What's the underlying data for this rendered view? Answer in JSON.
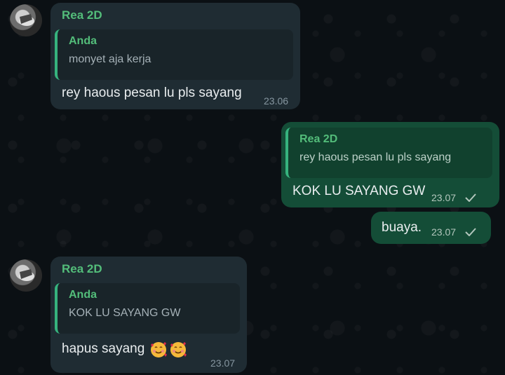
{
  "messages": [
    {
      "direction": "incoming",
      "sender": "Rea 2D",
      "quote_author": "Anda",
      "quote_text": "monyet aja kerja",
      "text": "rey haous pesan lu pls sayang",
      "time": "23.06"
    },
    {
      "direction": "outgoing",
      "quote_author": "Rea 2D",
      "quote_text": "rey haous pesan lu pls sayang",
      "text": "KOK LU SAYANG GW",
      "time": "23.07",
      "status": "check-icon"
    },
    {
      "direction": "outgoing",
      "text": "buaya.",
      "time": "23.07",
      "status": "check-icon"
    },
    {
      "direction": "incoming",
      "sender": "Rea 2D",
      "quote_author": "Anda",
      "quote_text": "KOK LU SAYANG GW",
      "text": "hapus sayang",
      "emoji": [
        "smiling-face-with-hearts-emoji",
        "smiling-face-with-hearts-emoji"
      ],
      "time": "23.07"
    }
  ],
  "colors": {
    "incoming_bubble": "#1f2c33",
    "outgoing_bubble": "#144d37",
    "accent": "#53bd7a",
    "background": "#0b1014"
  }
}
